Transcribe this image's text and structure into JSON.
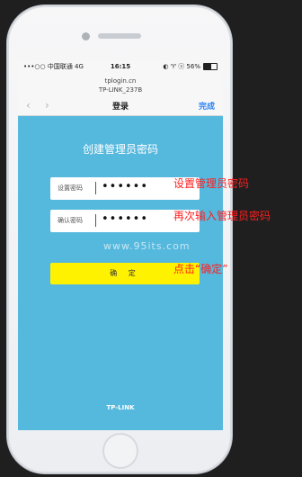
{
  "status_bar": {
    "carrier_signal": "•••○○ 中国联通 4G",
    "time": "16:15",
    "right_text": "◐ ♈ ⓥ 56%",
    "battery_level_percent": 56
  },
  "browser": {
    "domain": "tplogin.cn",
    "device_name": "TP-LINK_237B",
    "page_title": "登录",
    "done_label": "完成",
    "back_icon": "chevron-left-icon",
    "forward_icon": "chevron-right-icon"
  },
  "main": {
    "title": "创建管理员密码",
    "set_password_label": "设置密码",
    "set_password_value": "••••••",
    "confirm_password_label": "确认密码",
    "confirm_password_value": "••••••",
    "confirm_button": "确 定",
    "watermark": "www.95its.com",
    "footer_logo": "TP-LINK"
  },
  "annotations": {
    "step1": "设置管理员密码",
    "step2": "再次输入管理员密码",
    "step3": "点击“确定”"
  },
  "colors": {
    "screen_bg": "#55b8dd",
    "button_bg": "#fff200",
    "annotation": "#ff1e1e",
    "link_blue": "#2d83f0"
  }
}
